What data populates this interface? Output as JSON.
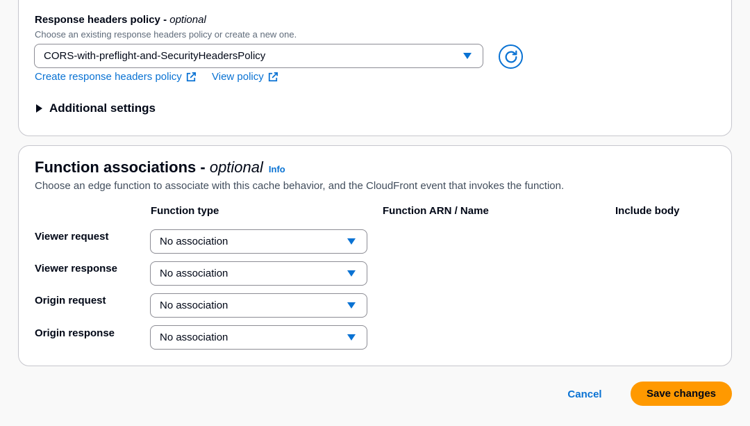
{
  "response_headers": {
    "title": "Response headers policy",
    "title_separator": " - ",
    "title_optional": "optional",
    "description": "Choose an existing response headers policy or create a new one.",
    "selected_value": "CORS-with-preflight-and-SecurityHeadersPolicy",
    "create_link": "Create response headers policy",
    "view_link": "View policy"
  },
  "additional_settings": {
    "label": "Additional settings"
  },
  "function_associations": {
    "title": "Function associations",
    "title_separator": " - ",
    "title_optional": "optional",
    "info_link": "Info",
    "description": "Choose an edge function to associate with this cache behavior, and the CloudFront event that invokes the function.",
    "columns": [
      "Function type",
      "Function ARN / Name",
      "Include body"
    ],
    "rows": [
      {
        "label": "Viewer request",
        "value": "No association"
      },
      {
        "label": "Viewer response",
        "value": "No association"
      },
      {
        "label": "Origin request",
        "value": "No association"
      },
      {
        "label": "Origin response",
        "value": "No association"
      }
    ]
  },
  "footer": {
    "cancel_label": "Cancel",
    "save_label": "Save changes"
  },
  "colors": {
    "accent": "#0972d3",
    "primary_button": "#ff9900",
    "border": "#c6c6cd"
  },
  "icons": {
    "refresh": "refresh-icon",
    "external": "external-link-icon",
    "caret": "caret-down-icon",
    "expander": "caret-right-icon"
  }
}
